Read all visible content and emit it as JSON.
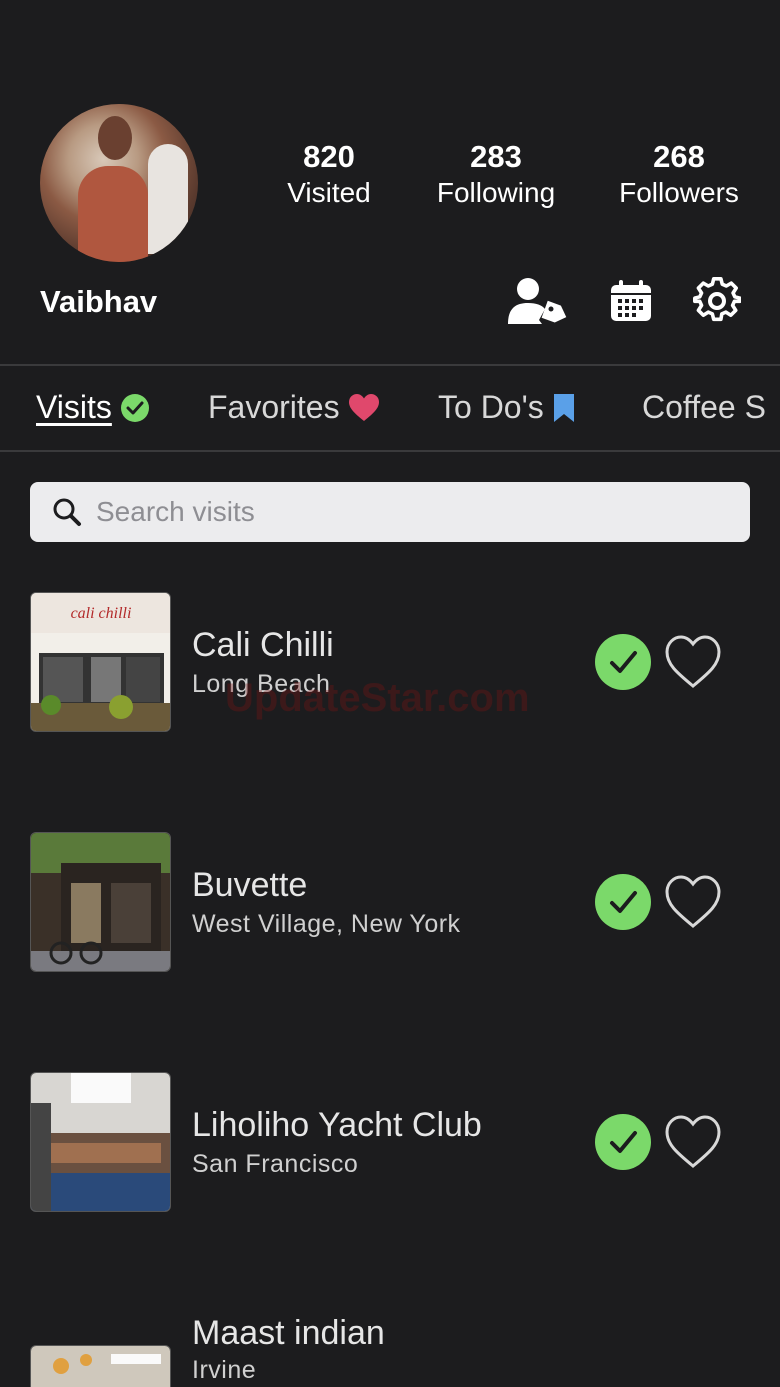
{
  "profile": {
    "username": "Vaibhav",
    "avatar_icon": "profile-photo",
    "stats": [
      {
        "value": "820",
        "label": "Visited"
      },
      {
        "value": "283",
        "label": "Following"
      },
      {
        "value": "268",
        "label": "Followers"
      }
    ],
    "actions": [
      "user-tag-icon",
      "calendar-icon",
      "gear-icon"
    ]
  },
  "tabs": [
    {
      "label": "Visits",
      "icon": "check-circle-icon",
      "active": true
    },
    {
      "label": "Favorites",
      "icon": "heart-icon",
      "active": false
    },
    {
      "label": "To Do's",
      "icon": "bookmark-icon",
      "active": false
    },
    {
      "label": "Coffee S",
      "icon": "",
      "active": false
    }
  ],
  "search": {
    "placeholder": "Search visits"
  },
  "visits": [
    {
      "name": "Cali Chilli",
      "location": "Long Beach",
      "visited": true,
      "favorite": false
    },
    {
      "name": "Buvette",
      "location": "West Village, New York",
      "visited": true,
      "favorite": false
    },
    {
      "name": "Liholiho Yacht Club",
      "location": "San Francisco",
      "visited": true,
      "favorite": false
    },
    {
      "name": "Maast indian",
      "location": "Irvine",
      "visited": true,
      "favorite": false
    }
  ],
  "thumb_labels": [
    "cali chilli"
  ],
  "watermark": "UpdateStar.com",
  "colors": {
    "background": "#1c1c1e",
    "check_green": "#7bd96a",
    "heart_pink": "#e0486c",
    "bookmark_blue": "#5aa0e8"
  }
}
